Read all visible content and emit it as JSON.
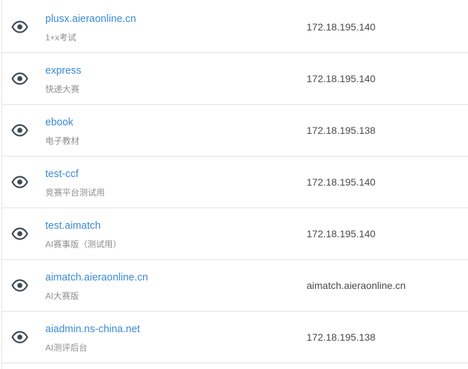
{
  "sites": [
    {
      "name": "plusx.aieraonline.cn",
      "desc": "1+x考试",
      "address": "172.18.195.140",
      "icon": "eye-icon"
    },
    {
      "name": "express",
      "desc": "快递大赛",
      "address": "172.18.195.140",
      "icon": "eye-icon"
    },
    {
      "name": "ebook",
      "desc": "电子教材",
      "address": "172.18.195.138",
      "icon": "eye-icon"
    },
    {
      "name": "test-ccf",
      "desc": "竞赛平台测试用",
      "address": "172.18.195.140",
      "icon": "eye-icon"
    },
    {
      "name": "test.aimatch",
      "desc": "AI赛事版（测试用）",
      "address": "172.18.195.140",
      "icon": "eye-icon"
    },
    {
      "name": "aimatch.aieraonline.cn",
      "desc": "AI大赛版",
      "address": "aimatch.aieraonline.cn",
      "icon": "eye-icon"
    },
    {
      "name": "aiadmin.ns-china.net",
      "desc": "AI测评后台",
      "address": "172.18.195.138",
      "icon": "eye-icon"
    }
  ],
  "colors": {
    "link": "#3a8ad6",
    "icon": "#3d4a55",
    "muted": "#8e8e8e",
    "divider": "#e3e3e3"
  }
}
